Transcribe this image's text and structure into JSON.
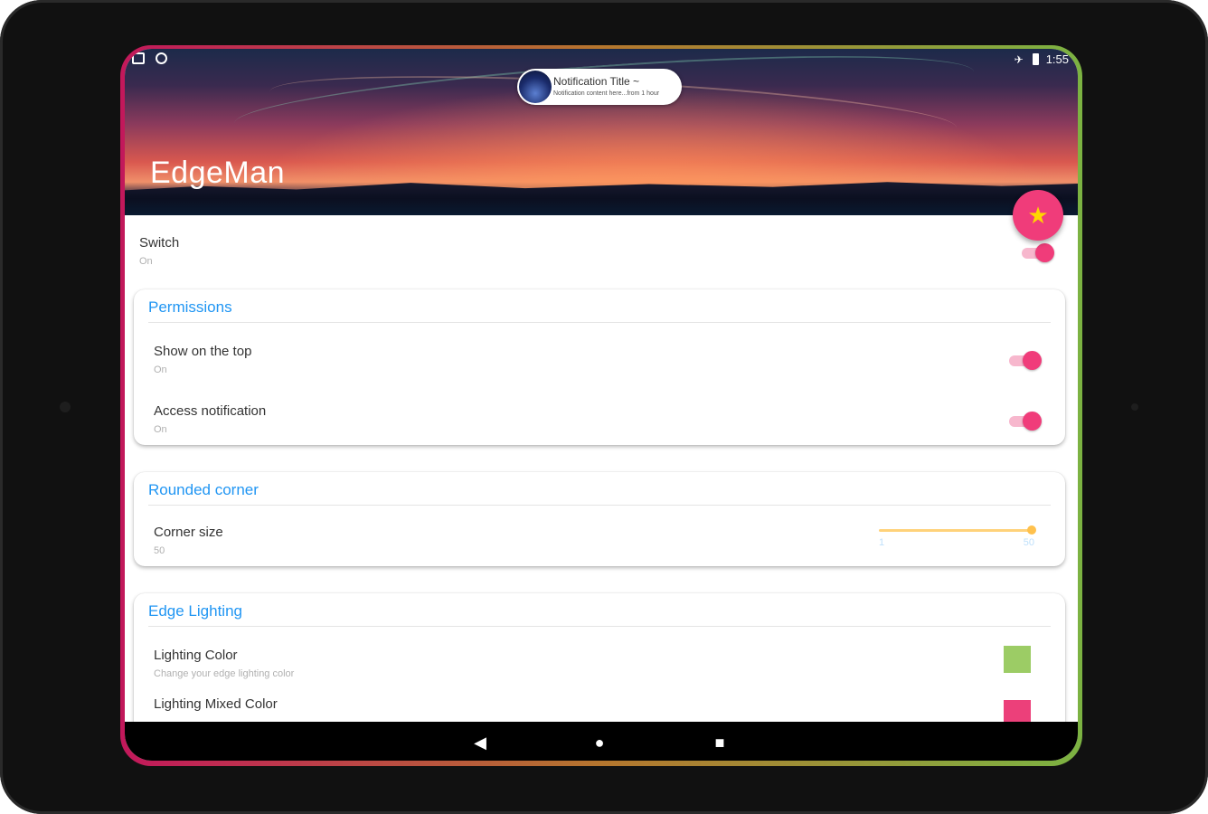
{
  "status_bar": {
    "left_icons": [
      "message-icon",
      "sync-icon"
    ],
    "right_icons": [
      "airplane-icon",
      "battery-icon"
    ],
    "time": "1:55"
  },
  "notification_preview": {
    "title": "Notification Title ~",
    "body": "Notification content here...from 1 hour"
  },
  "header": {
    "app_title": "EdgeMan"
  },
  "fab": {
    "icon": "star-icon",
    "glyph": "★"
  },
  "switch_row": {
    "title": "Switch",
    "subtitle": "On",
    "enabled": true
  },
  "permissions": {
    "header": "Permissions",
    "items": [
      {
        "title": "Show on the top",
        "subtitle": "On",
        "enabled": true
      },
      {
        "title": "Access notification",
        "subtitle": "On",
        "enabled": true
      }
    ]
  },
  "rounded_corner": {
    "header": "Rounded corner",
    "corner_size": {
      "title": "Corner size",
      "subtitle": "50",
      "min": "1",
      "max": "50",
      "value": 50
    }
  },
  "edge_lighting": {
    "header": "Edge Lighting",
    "items": [
      {
        "title": "Lighting Color",
        "subtitle": "Change your edge lighting color",
        "color": "#8bc34a"
      },
      {
        "title": "Lighting Mixed Color",
        "color": "#e91e63"
      }
    ]
  },
  "nav_bar": {
    "back_glyph": "◀",
    "home_glyph": "●",
    "recents_glyph": "■"
  },
  "colors": {
    "accent": "#f03c7a",
    "section_header": "#2196f3",
    "slider": "#ffc14d"
  }
}
